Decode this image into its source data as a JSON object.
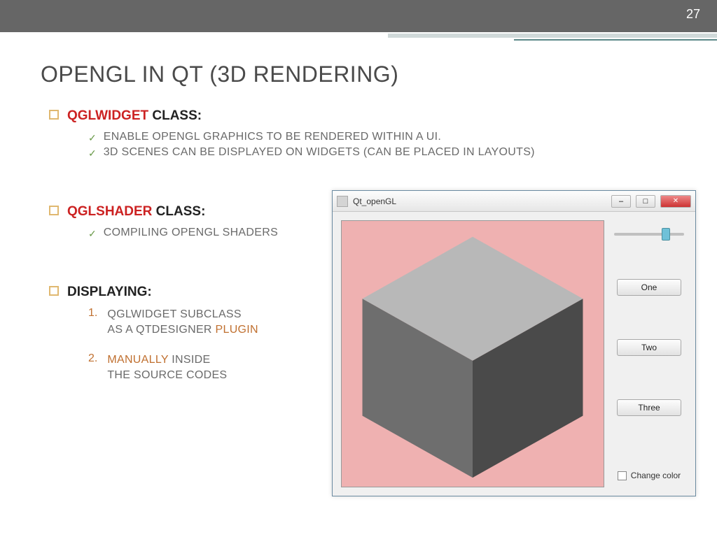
{
  "slide_number": "27",
  "title": "OPENGL IN QT  (3D RENDERING)",
  "sections": {
    "widget": {
      "heading_hl": "QGLWIDGET",
      "heading_rest": " CLASS",
      "items": [
        "ENABLE OPENGL GRAPHICS TO BE RENDERED WITHIN A UI.",
        "3D SCENES CAN BE DISPLAYED ON WIDGETS (CAN BE PLACED IN LAYOUTS)"
      ]
    },
    "shader": {
      "heading_hl": "QGLSHADER",
      "heading_rest": " CLASS",
      "items": [
        "COMPILING OPENGL SHADERS"
      ]
    },
    "displaying": {
      "heading_bold": "DISPLAYING",
      "ord": [
        {
          "num": "1.",
          "pre": "QGLWIDGET SUBCLASS\nAS A QTDESIGNER ",
          "hl": "PLUGIN",
          "post": ""
        },
        {
          "num": "2.",
          "pre": "",
          "hl": "MANUALLY",
          "post": " INSIDE\nTHE SOURCE CODES"
        }
      ]
    }
  },
  "qt_window": {
    "title": "Qt_openGL",
    "buttons": [
      "One",
      "Two",
      "Three"
    ],
    "slider_pos_percent": 68,
    "checkbox_label": "Change color",
    "checkbox_checked": false
  }
}
